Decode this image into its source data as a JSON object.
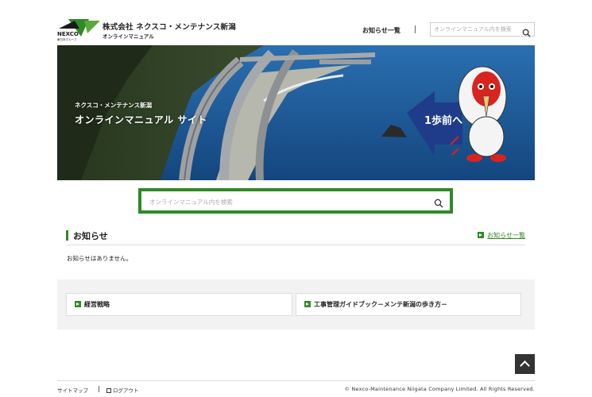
{
  "header": {
    "logo_text": "NEXCO",
    "logo_subtext": "東日本グループ",
    "company": "株式会社 ネクスコ・メンテナンス新潟",
    "subtitle": "オンラインマニュアル",
    "news_link": "お知らせ一覧",
    "search_placeholder": "オンラインマニュアル内を検索"
  },
  "hero": {
    "small_text": "ネクスコ・メンテナンス新潟",
    "title": "オンラインマニュアル サイト",
    "sign_text": "1歩前へ"
  },
  "main_search": {
    "placeholder": "オンラインマニュアル内を検索"
  },
  "notices": {
    "title": "お知らせ",
    "all_link": "お知らせ一覧",
    "empty_message": "お知らせはありません。"
  },
  "links": [
    {
      "label": "経営戦略"
    },
    {
      "label": "工事管理ガイドブック－メンテ新潟の歩き方－"
    }
  ],
  "footer": {
    "sitemap": "サイトマップ",
    "logout": "ログアウト",
    "copyright": "© Nexco-Maintenance Niigata Company Limited. All Rights Reserved."
  },
  "colors": {
    "accent": "#2e8a25",
    "sea": "#1f5e9c",
    "mascot_red": "#d8231f"
  }
}
